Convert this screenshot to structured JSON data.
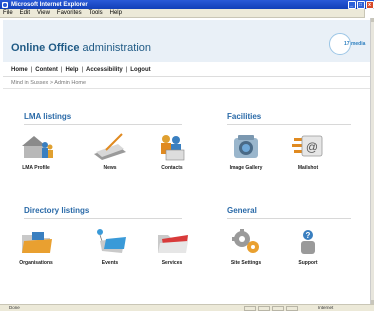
{
  "window": {
    "title": "Microsoft Internet Explorer",
    "buttons": [
      "_",
      "□",
      "x"
    ]
  },
  "menu": [
    "File",
    "Edit",
    "View",
    "Favorites",
    "Tools",
    "Help"
  ],
  "site": {
    "title_brand": "Online Office",
    "title_rest": " administration",
    "badge": "17 media"
  },
  "nav": [
    "Home",
    "Content",
    "Help",
    "Accessibility",
    "Logout"
  ],
  "breadcrumb": "Mind in Sussex > Admin Home",
  "sections": {
    "lma": {
      "title": "LMA listings",
      "items": [
        "LMA Profile",
        "News",
        "Contacts"
      ]
    },
    "facilities": {
      "title": "Facilities",
      "items": [
        "Image Gallery",
        "Mailshot"
      ]
    },
    "directory": {
      "title": "Directory listings",
      "items": [
        "Organisations",
        "Events",
        "Services"
      ]
    },
    "general": {
      "title": "General",
      "items": [
        "Site Settings",
        "Support"
      ]
    }
  },
  "icons": {
    "lma": [
      "house-people-icon",
      "pen-paper-icon",
      "contacts-icon"
    ],
    "facilities": [
      "camera-icon",
      "mail-at-icon"
    ],
    "directory": [
      "folder-icon",
      "folder-pins-icon",
      "folder-red-icon"
    ],
    "general": [
      "gears-icon",
      "support-person-icon"
    ]
  },
  "status": {
    "left": "Done",
    "zone": "Internet"
  }
}
